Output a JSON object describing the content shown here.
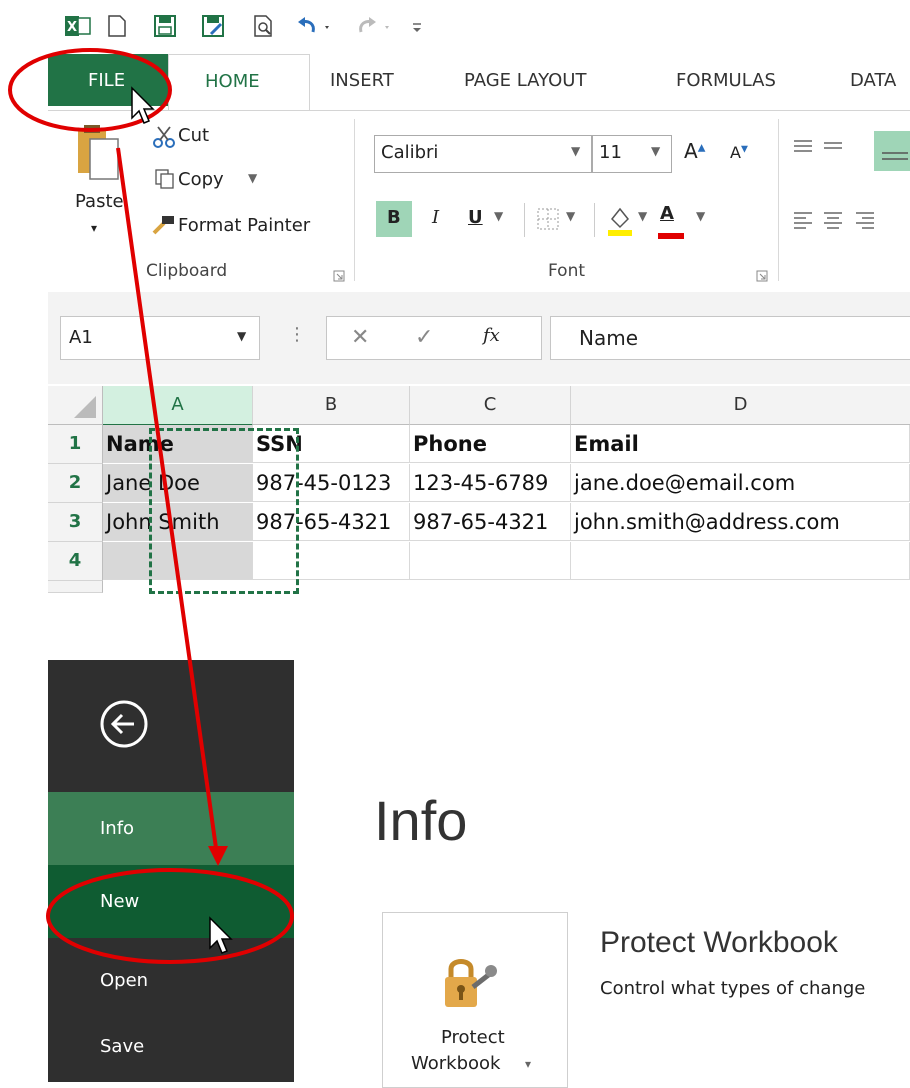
{
  "ribbon_tabs": {
    "file": "FILE",
    "home": "HOME",
    "insert": "INSERT",
    "page_layout": "PAGE LAYOUT",
    "formulas": "FORMULAS",
    "data": "DATA"
  },
  "clipboard": {
    "paste": "Paste",
    "cut": "Cut",
    "copy": "Copy",
    "format_painter": "Format Painter",
    "group_label": "Clipboard"
  },
  "font_group": {
    "font_name": "Calibri",
    "font_size": "11",
    "group_label": "Font",
    "bold": "B",
    "italic": "I",
    "underline": "U",
    "font_color_glyph": "A"
  },
  "formula_bar": {
    "name_box": "A1",
    "fx": "fx",
    "content": "Name"
  },
  "sheet": {
    "columns": [
      "A",
      "B",
      "C",
      "D"
    ],
    "rows": [
      {
        "num": "1",
        "cells": [
          "Name",
          "SSN",
          "Phone",
          "Email"
        ]
      },
      {
        "num": "2",
        "cells": [
          "Jane Doe",
          "987-45-0123",
          "123-45-6789",
          "jane.doe@email.com"
        ]
      },
      {
        "num": "3",
        "cells": [
          "John Smith",
          "987-65-4321",
          "987-65-4321",
          "john.smith@address.com"
        ]
      },
      {
        "num": "4",
        "cells": [
          "",
          "",
          "",
          ""
        ]
      }
    ]
  },
  "backstage": {
    "menu": [
      "Info",
      "New",
      "Open",
      "Save"
    ],
    "title": "Info",
    "protect_button_line1": "Protect",
    "protect_button_line2": "Workbook",
    "protect_heading": "Protect Workbook",
    "protect_desc": "Control what types of change"
  },
  "colors": {
    "excel_green": "#217346",
    "annotation_red": "#e00000",
    "sidebar": "#2f2f2f",
    "info_highlight": "#3c7f55",
    "new_highlight": "#0f5c32"
  }
}
